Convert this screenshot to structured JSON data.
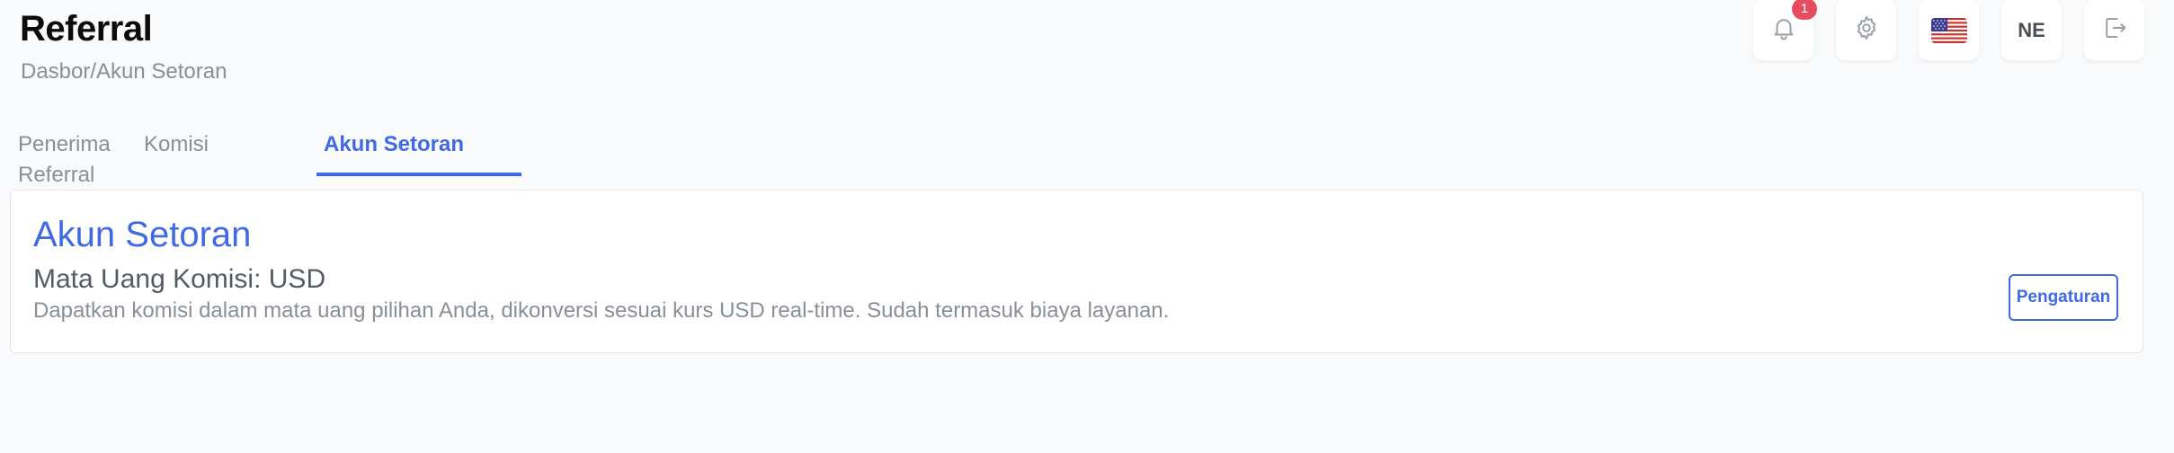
{
  "header": {
    "title": "Referral",
    "breadcrumb": "Dasbor/Akun Setoran"
  },
  "topbar": {
    "notification_icon": "bell-icon",
    "notification_count": "1",
    "settings_icon": "gear-icon",
    "language_flag": "us-flag-icon",
    "user_initials": "NE",
    "logout_icon": "logout-icon"
  },
  "tabs": [
    {
      "label": "Penerima Referral",
      "active": false
    },
    {
      "label": "Komisi",
      "active": false
    },
    {
      "label": "Akun Setoran",
      "active": true
    }
  ],
  "card": {
    "title": "Akun Setoran",
    "subtitle": "Mata Uang Komisi: USD",
    "description": "Dapatkan komisi dalam mata uang pilihan Anda, dikonversi sesuai kurs USD real-time. Sudah termasuk biaya layanan.",
    "button_label": "Pengaturan"
  },
  "colors": {
    "accent": "#4169e1",
    "badge": "#e84a5f",
    "background": "#f9fafc"
  }
}
